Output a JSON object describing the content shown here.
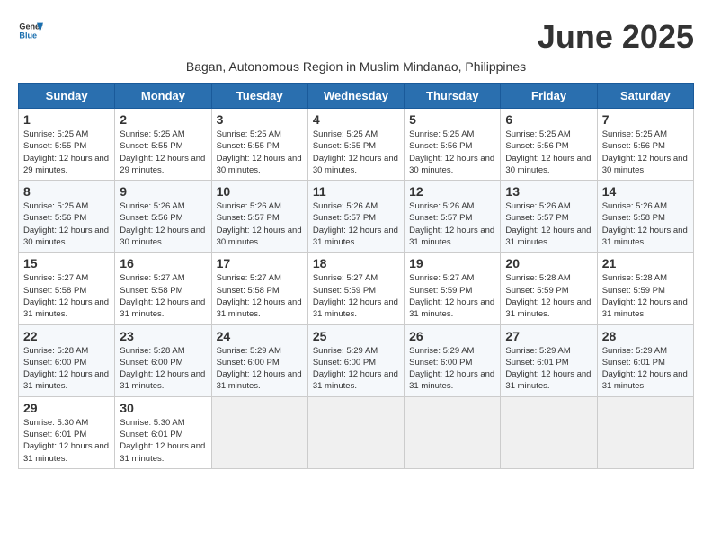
{
  "header": {
    "logo_line1": "General",
    "logo_line2": "Blue",
    "month_title": "June 2025",
    "subtitle": "Bagan, Autonomous Region in Muslim Mindanao, Philippines"
  },
  "calendar": {
    "days_of_week": [
      "Sunday",
      "Monday",
      "Tuesday",
      "Wednesday",
      "Thursday",
      "Friday",
      "Saturday"
    ],
    "weeks": [
      [
        {
          "date": "",
          "empty": true
        },
        {
          "date": "",
          "empty": true
        },
        {
          "date": "",
          "empty": true
        },
        {
          "date": "",
          "empty": true
        },
        {
          "date": "",
          "empty": true
        },
        {
          "date": "",
          "empty": true
        },
        {
          "date": "",
          "empty": true
        }
      ],
      [
        {
          "date": "1",
          "sunrise": "Sunrise: 5:25 AM",
          "sunset": "Sunset: 5:55 PM",
          "daylight": "Daylight: 12 hours and 29 minutes."
        },
        {
          "date": "2",
          "sunrise": "Sunrise: 5:25 AM",
          "sunset": "Sunset: 5:55 PM",
          "daylight": "Daylight: 12 hours and 29 minutes."
        },
        {
          "date": "3",
          "sunrise": "Sunrise: 5:25 AM",
          "sunset": "Sunset: 5:55 PM",
          "daylight": "Daylight: 12 hours and 30 minutes."
        },
        {
          "date": "4",
          "sunrise": "Sunrise: 5:25 AM",
          "sunset": "Sunset: 5:55 PM",
          "daylight": "Daylight: 12 hours and 30 minutes."
        },
        {
          "date": "5",
          "sunrise": "Sunrise: 5:25 AM",
          "sunset": "Sunset: 5:56 PM",
          "daylight": "Daylight: 12 hours and 30 minutes."
        },
        {
          "date": "6",
          "sunrise": "Sunrise: 5:25 AM",
          "sunset": "Sunset: 5:56 PM",
          "daylight": "Daylight: 12 hours and 30 minutes."
        },
        {
          "date": "7",
          "sunrise": "Sunrise: 5:25 AM",
          "sunset": "Sunset: 5:56 PM",
          "daylight": "Daylight: 12 hours and 30 minutes."
        }
      ],
      [
        {
          "date": "8",
          "sunrise": "Sunrise: 5:25 AM",
          "sunset": "Sunset: 5:56 PM",
          "daylight": "Daylight: 12 hours and 30 minutes."
        },
        {
          "date": "9",
          "sunrise": "Sunrise: 5:26 AM",
          "sunset": "Sunset: 5:56 PM",
          "daylight": "Daylight: 12 hours and 30 minutes."
        },
        {
          "date": "10",
          "sunrise": "Sunrise: 5:26 AM",
          "sunset": "Sunset: 5:57 PM",
          "daylight": "Daylight: 12 hours and 30 minutes."
        },
        {
          "date": "11",
          "sunrise": "Sunrise: 5:26 AM",
          "sunset": "Sunset: 5:57 PM",
          "daylight": "Daylight: 12 hours and 31 minutes."
        },
        {
          "date": "12",
          "sunrise": "Sunrise: 5:26 AM",
          "sunset": "Sunset: 5:57 PM",
          "daylight": "Daylight: 12 hours and 31 minutes."
        },
        {
          "date": "13",
          "sunrise": "Sunrise: 5:26 AM",
          "sunset": "Sunset: 5:57 PM",
          "daylight": "Daylight: 12 hours and 31 minutes."
        },
        {
          "date": "14",
          "sunrise": "Sunrise: 5:26 AM",
          "sunset": "Sunset: 5:58 PM",
          "daylight": "Daylight: 12 hours and 31 minutes."
        }
      ],
      [
        {
          "date": "15",
          "sunrise": "Sunrise: 5:27 AM",
          "sunset": "Sunset: 5:58 PM",
          "daylight": "Daylight: 12 hours and 31 minutes."
        },
        {
          "date": "16",
          "sunrise": "Sunrise: 5:27 AM",
          "sunset": "Sunset: 5:58 PM",
          "daylight": "Daylight: 12 hours and 31 minutes."
        },
        {
          "date": "17",
          "sunrise": "Sunrise: 5:27 AM",
          "sunset": "Sunset: 5:58 PM",
          "daylight": "Daylight: 12 hours and 31 minutes."
        },
        {
          "date": "18",
          "sunrise": "Sunrise: 5:27 AM",
          "sunset": "Sunset: 5:59 PM",
          "daylight": "Daylight: 12 hours and 31 minutes."
        },
        {
          "date": "19",
          "sunrise": "Sunrise: 5:27 AM",
          "sunset": "Sunset: 5:59 PM",
          "daylight": "Daylight: 12 hours and 31 minutes."
        },
        {
          "date": "20",
          "sunrise": "Sunrise: 5:28 AM",
          "sunset": "Sunset: 5:59 PM",
          "daylight": "Daylight: 12 hours and 31 minutes."
        },
        {
          "date": "21",
          "sunrise": "Sunrise: 5:28 AM",
          "sunset": "Sunset: 5:59 PM",
          "daylight": "Daylight: 12 hours and 31 minutes."
        }
      ],
      [
        {
          "date": "22",
          "sunrise": "Sunrise: 5:28 AM",
          "sunset": "Sunset: 6:00 PM",
          "daylight": "Daylight: 12 hours and 31 minutes."
        },
        {
          "date": "23",
          "sunrise": "Sunrise: 5:28 AM",
          "sunset": "Sunset: 6:00 PM",
          "daylight": "Daylight: 12 hours and 31 minutes."
        },
        {
          "date": "24",
          "sunrise": "Sunrise: 5:29 AM",
          "sunset": "Sunset: 6:00 PM",
          "daylight": "Daylight: 12 hours and 31 minutes."
        },
        {
          "date": "25",
          "sunrise": "Sunrise: 5:29 AM",
          "sunset": "Sunset: 6:00 PM",
          "daylight": "Daylight: 12 hours and 31 minutes."
        },
        {
          "date": "26",
          "sunrise": "Sunrise: 5:29 AM",
          "sunset": "Sunset: 6:00 PM",
          "daylight": "Daylight: 12 hours and 31 minutes."
        },
        {
          "date": "27",
          "sunrise": "Sunrise: 5:29 AM",
          "sunset": "Sunset: 6:01 PM",
          "daylight": "Daylight: 12 hours and 31 minutes."
        },
        {
          "date": "28",
          "sunrise": "Sunrise: 5:29 AM",
          "sunset": "Sunset: 6:01 PM",
          "daylight": "Daylight: 12 hours and 31 minutes."
        }
      ],
      [
        {
          "date": "29",
          "sunrise": "Sunrise: 5:30 AM",
          "sunset": "Sunset: 6:01 PM",
          "daylight": "Daylight: 12 hours and 31 minutes."
        },
        {
          "date": "30",
          "sunrise": "Sunrise: 5:30 AM",
          "sunset": "Sunset: 6:01 PM",
          "daylight": "Daylight: 12 hours and 31 minutes."
        },
        {
          "date": "",
          "empty": true
        },
        {
          "date": "",
          "empty": true
        },
        {
          "date": "",
          "empty": true
        },
        {
          "date": "",
          "empty": true
        },
        {
          "date": "",
          "empty": true
        }
      ]
    ]
  }
}
